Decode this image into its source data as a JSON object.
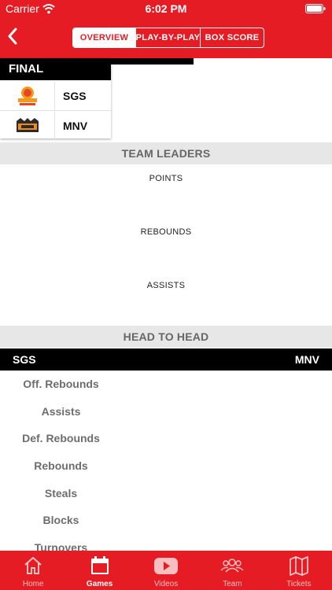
{
  "status_bar": {
    "carrier": "Carrier",
    "time": "6:02 PM"
  },
  "nav": {
    "tabs": [
      {
        "label": "OVERVIEW",
        "active": true
      },
      {
        "label": "PLAY-BY-PLAY",
        "active": false
      },
      {
        "label": "BOX SCORE",
        "active": false
      }
    ]
  },
  "game": {
    "status": "FINAL",
    "home": {
      "abbr": "SGS",
      "logo_text": "SINGAPORE SLINGERS"
    },
    "away": {
      "abbr": "MNV",
      "logo_text": "MONO"
    }
  },
  "team_leaders": {
    "title": "TEAM LEADERS",
    "categories": [
      "POINTS",
      "REBOUNDS",
      "ASSISTS"
    ]
  },
  "head_to_head": {
    "title": "HEAD TO HEAD",
    "home": "SGS",
    "away": "MNV",
    "stats": [
      "Off. Rebounds",
      "Assists",
      "Def. Rebounds",
      "Rebounds",
      "Steals",
      "Blocks",
      "Turnovers"
    ]
  },
  "tabbar": {
    "items": [
      {
        "label": "Home",
        "icon": "home-icon"
      },
      {
        "label": "Games",
        "icon": "calendar-icon",
        "active": true
      },
      {
        "label": "Videos",
        "icon": "youtube-icon"
      },
      {
        "label": "Team",
        "icon": "team-icon"
      },
      {
        "label": "Tickets",
        "icon": "map-icon"
      }
    ]
  },
  "colors": {
    "brand_red": "#e51c23",
    "black": "#000000",
    "section_gray": "#e7e7e7"
  }
}
